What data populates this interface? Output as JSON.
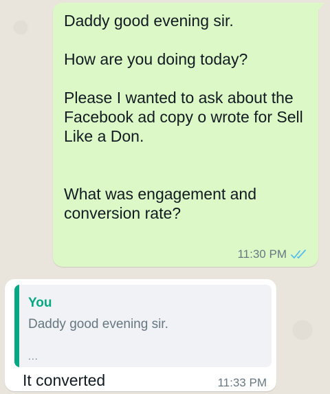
{
  "messages": {
    "outgoing": {
      "text": "Daddy good evening sir.\n\nHow are you doing today?\n\nPlease I wanted to ask about the Facebook ad copy o wrote for Sell Like a Don.\n\n\nWhat was engagement and conversion rate?",
      "time": "11:30 PM",
      "status_icon": "double-check-read-icon",
      "status_color": "#53bdeb"
    },
    "incoming": {
      "quote": {
        "author": "You",
        "text": "Daddy good evening sir.",
        "ellipsis": "..."
      },
      "text": "It converted",
      "time": "11:33 PM"
    }
  },
  "colors": {
    "background": "#e9e4dc",
    "outgoing_bubble": "#dcf8c6",
    "incoming_bubble": "#ffffff",
    "quote_accent": "#06a884"
  }
}
